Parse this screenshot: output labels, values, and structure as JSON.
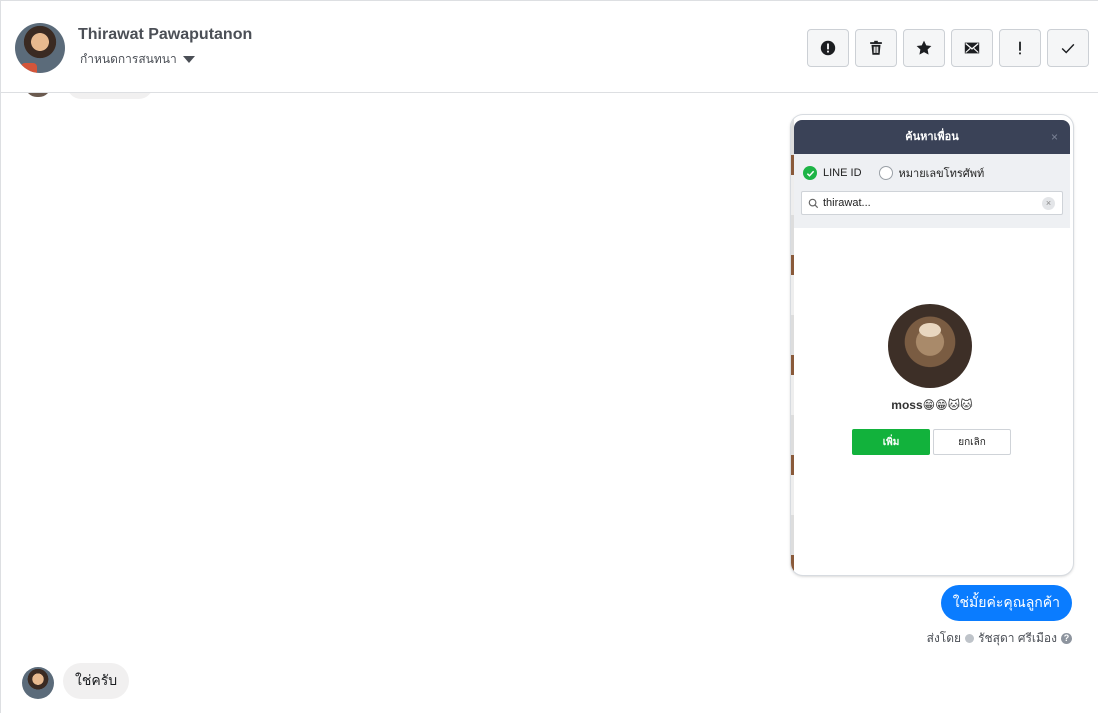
{
  "header": {
    "contact_name": "Thirawat Pawaputanon",
    "assign_label": "กำหนดการสนทนา",
    "actions": [
      {
        "icon": "alert-circle-icon",
        "name": "report-button"
      },
      {
        "icon": "trash-icon",
        "name": "delete-button"
      },
      {
        "icon": "star-icon",
        "name": "star-button"
      },
      {
        "icon": "envelope-icon",
        "name": "mark-unread-button"
      },
      {
        "icon": "exclamation-icon",
        "name": "spam-button"
      },
      {
        "icon": "checkmark-icon",
        "name": "done-button"
      }
    ]
  },
  "thread": {
    "screenshot": {
      "dialog_title": "ค้นหาเพื่อน",
      "close_glyph": "×",
      "option_line_id": "LINE ID",
      "option_phone": "หมายเลขโทรศัพท์",
      "search_value": "thirawat...",
      "profile_name": "moss😁😁🐱🐱",
      "add_label": "เพิ่ม",
      "cancel_label": "ยกเลิก"
    },
    "outgoing_message": "ใช่มั้ยค่ะคุณลูกค้า",
    "sent_by_prefix": "ส่งโดย",
    "sent_by_name": "รัชสุดา ศรีเมือง",
    "help_glyph": "?",
    "incoming_message": "ใช่ครับ"
  },
  "colors": {
    "outgoing_bubble": "#0a7cff",
    "incoming_bubble": "#f1f0f0",
    "line_green": "#12b23c",
    "dialog_header": "#3a4257"
  }
}
